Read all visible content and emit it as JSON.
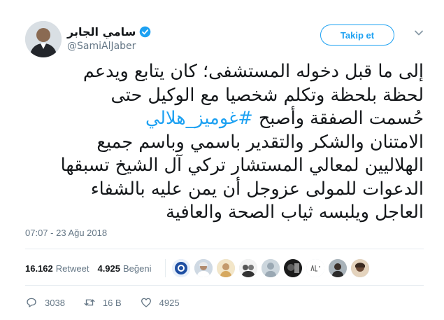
{
  "header": {
    "display_name": "سامي الجابر",
    "handle": "@SamiAlJaber",
    "verified_icon": "verified-badge-icon",
    "follow_label": "Takip et",
    "menu_icon": "chevron-down-icon"
  },
  "tweet": {
    "lines": [
      "إلى ما قبل دخوله المستشفى؛ كان يتابع ويدعم",
      "لحظة بلحظة وتكلم شخصيا مع الوكيل حتى",
      "حُسمت الصفقة وأصبح",
      "الامتنان والشكر والتقدير باسمي وباسم جميع",
      "الهلاليين لمعالي المستشار تركي آل الشيخ تسبقها",
      "الدعوات للمولى عزوجل أن يمن عليه بالشفاء",
      "العاجل ويلبسه ثياب الصحة والعافية"
    ],
    "hashtag": "#غوميز_هلالي",
    "timestamp": "07:07 - 23 Ağu 2018"
  },
  "stats": {
    "retweets": "16.162",
    "retweets_label": "Retweet",
    "likes": "4.925",
    "likes_label": "Beğeni"
  },
  "actions": {
    "reply_count": "3038",
    "retweet_count": "16 B",
    "like_count": "4925"
  },
  "colors": {
    "accent": "#1da1f2",
    "text": "#14171a",
    "muted": "#657786",
    "divider": "#e6ecf0"
  }
}
